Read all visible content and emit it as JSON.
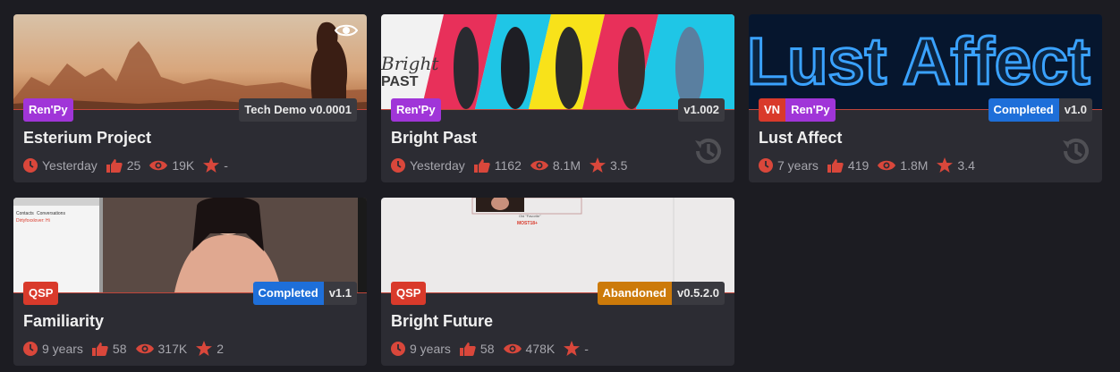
{
  "cards": [
    {
      "title": "Esterium Project",
      "engine": "Ren'Py",
      "version": "Tech Demo v0.0001",
      "updated": "Yesterday",
      "likes": "25",
      "views": "19K",
      "rating": "-"
    },
    {
      "title": "Bright Past",
      "engine": "Ren'Py",
      "version": "v1.002",
      "updated": "Yesterday",
      "likes": "1162",
      "views": "8.1M",
      "rating": "3.5",
      "thumb_text": [
        "Bright",
        "PAST"
      ]
    },
    {
      "title": "Lust Affect",
      "prefix": "VN",
      "engine": "Ren'Py",
      "status": "Completed",
      "version": "v1.0",
      "updated": "7 years",
      "likes": "419",
      "views": "1.8M",
      "rating": "3.4",
      "thumb_text": "Lust Affect"
    },
    {
      "title": "Familiarity",
      "engine": "QSP",
      "status": "Completed",
      "version": "v1.1",
      "updated": "9 years",
      "likes": "58",
      "views": "317K",
      "rating": "2",
      "thumb_text": [
        "Contacts",
        "Conversations",
        "Dirtyfoxxlover: Hi"
      ]
    },
    {
      "title": "Bright Future",
      "engine": "QSP",
      "status": "Abandoned",
      "version": "v0.5.2.0",
      "updated": "9 years",
      "likes": "58",
      "views": "478K",
      "rating": "-",
      "thumb_text": [
        "Old \"Favorite\"",
        "MOST18+"
      ]
    }
  ],
  "colors": {
    "accent": "#d9473b",
    "renpy": "#a035d8",
    "completed": "#1e6fd9",
    "abandoned": "#cc7a0a"
  }
}
